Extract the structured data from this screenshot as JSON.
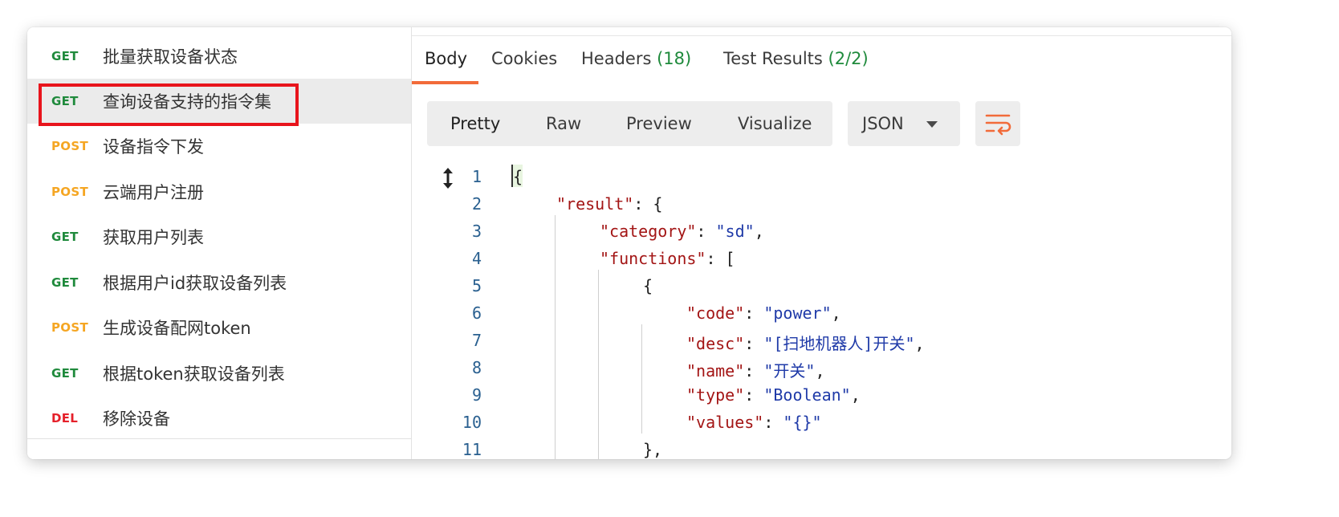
{
  "sidebar": {
    "requests": [
      {
        "method": "GET",
        "method_color": "#1f8a3c",
        "name": "批量获取设备状态"
      },
      {
        "method": "GET",
        "method_color": "#1f8a3c",
        "name": "查询设备支持的指令集",
        "selected": true
      },
      {
        "method": "POST",
        "method_color": "#f5a623",
        "name": "设备指令下发"
      },
      {
        "method": "POST",
        "method_color": "#f5a623",
        "name": "云端用户注册"
      },
      {
        "method": "GET",
        "method_color": "#1f8a3c",
        "name": "获取用户列表"
      },
      {
        "method": "GET",
        "method_color": "#1f8a3c",
        "name": "根据用户id获取设备列表"
      },
      {
        "method": "POST",
        "method_color": "#f5a623",
        "name": "生成设备配网token"
      },
      {
        "method": "GET",
        "method_color": "#1f8a3c",
        "name": "根据token获取设备列表"
      },
      {
        "method": "DEL",
        "method_color": "#e5202a",
        "name": "移除设备"
      }
    ]
  },
  "response": {
    "tabs": {
      "body": "Body",
      "cookies": "Cookies",
      "headers": "Headers",
      "headers_count": "(18)",
      "tests": "Test Results",
      "tests_count": "(2/2)"
    },
    "toolbar": {
      "pretty": "Pretty",
      "raw": "Raw",
      "preview": "Preview",
      "visualize": "Visualize",
      "format": "JSON"
    },
    "accent_color": "#f26b3a",
    "code": [
      {
        "n": "1",
        "text": "{"
      },
      {
        "n": "2",
        "key": "\"result\"",
        "rest": ": {"
      },
      {
        "n": "3",
        "key": "\"category\"",
        "rest": ": ",
        "str": "\"sd\"",
        "tail": ","
      },
      {
        "n": "4",
        "key": "\"functions\"",
        "rest": ": ["
      },
      {
        "n": "5",
        "text": "{"
      },
      {
        "n": "6",
        "key": "\"code\"",
        "rest": ": ",
        "str": "\"power\"",
        "tail": ","
      },
      {
        "n": "7",
        "key": "\"desc\"",
        "rest": ": ",
        "str": "\"[扫地机器人]开关\"",
        "tail": ","
      },
      {
        "n": "8",
        "key": "\"name\"",
        "rest": ": ",
        "str": "\"开关\"",
        "tail": ","
      },
      {
        "n": "9",
        "key": "\"type\"",
        "rest": ": ",
        "str": "\"Boolean\"",
        "tail": ","
      },
      {
        "n": "10",
        "key": "\"values\"",
        "rest": ": ",
        "str": "\"{}\"",
        "tail": ""
      },
      {
        "n": "11",
        "text": "},"
      }
    ]
  }
}
